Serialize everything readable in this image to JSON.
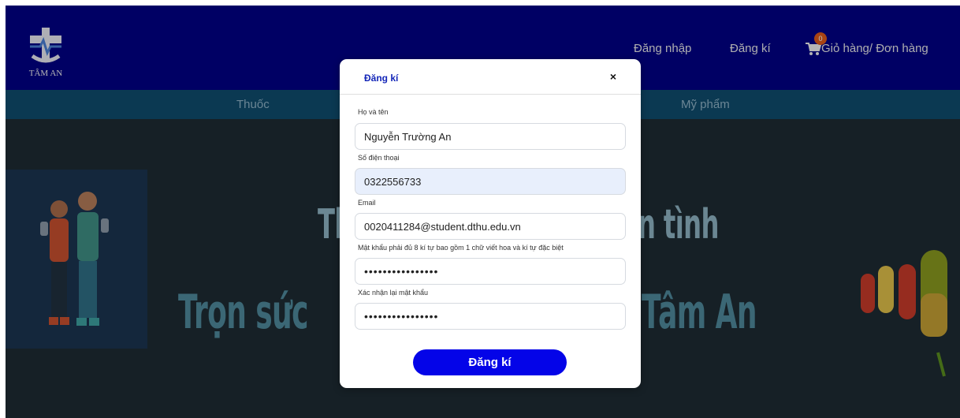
{
  "brand": {
    "name": "TÂM AN"
  },
  "header_nav": {
    "login": "Đăng nhập",
    "register": "Đăng kí",
    "cart_label": "Giỏ hàng/ Đơn hàng",
    "cart_count": "0"
  },
  "categories": [
    "Thuốc",
    "Mỹ phẩm"
  ],
  "banner": {
    "line1_fragments": [
      "Th",
      "n tình"
    ],
    "line2_fragments": [
      "Trọn sức",
      "Tâm An"
    ]
  },
  "modal": {
    "title": "Đăng kí",
    "close_symbol": "×",
    "fields": {
      "fullname": {
        "label": "Họ và tên",
        "value": "Nguyễn Trường An"
      },
      "phone": {
        "label": "Số điện thoại",
        "value": "0322556733"
      },
      "email": {
        "label": "Email",
        "value": "0020411284@student.dthu.edu.vn"
      },
      "password": {
        "label": "Mật khẩu phải đủ 8 kí tự bao gồm 1 chữ viết hoa và kí tự đặc biệt",
        "value": "••••••••••••••••"
      },
      "confirm_password": {
        "label": "Xác nhận lại mật khẩu",
        "value": "••••••••••••••••"
      }
    },
    "submit_label": "Đăng kí"
  },
  "colors": {
    "header": "#010186",
    "category_bar": "#0f4c6e",
    "submit_button": "#0404e8",
    "title_text": "#1426b8"
  },
  "icons": [
    "logo-cross-icon",
    "cart-icon",
    "close-icon"
  ]
}
